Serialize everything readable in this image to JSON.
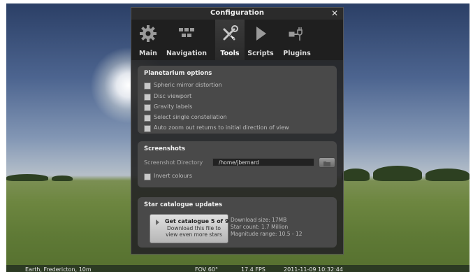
{
  "dialog": {
    "title": "Configuration",
    "close": "✕",
    "tabs": [
      {
        "label": "Main",
        "icon": "gear-icon"
      },
      {
        "label": "Navigation",
        "icon": "navigation-icon"
      },
      {
        "label": "Tools",
        "icon": "wrench-icon"
      },
      {
        "label": "Scripts",
        "icon": "play-icon"
      },
      {
        "label": "Plugins",
        "icon": "plug-icon"
      }
    ],
    "active_tab": "Tools"
  },
  "planetarium": {
    "title": "Planetarium options",
    "options": [
      {
        "label": "Spheric mirror distortion",
        "checked": false
      },
      {
        "label": "Disc viewport",
        "checked": false
      },
      {
        "label": "Gravity labels",
        "checked": false
      },
      {
        "label": "Select single constellation",
        "checked": false
      },
      {
        "label": "Auto zoom out returns to initial direction of view",
        "checked": false
      }
    ]
  },
  "screenshots": {
    "title": "Screenshots",
    "dir_label": "Screenshot Directory",
    "dir_value": "/home/jbernard",
    "invert_label": "Invert colours",
    "invert_checked": false
  },
  "catalogue": {
    "title": "Star catalogue updates",
    "button_title": "Get catalogue 5 of 9",
    "button_line1": "Download this file to",
    "button_line2": "view even more stars",
    "info": [
      "Download size: 17MB",
      "Star count: 1.7 Million",
      "Magnitude range: 10.5 - 12"
    ]
  },
  "status": {
    "location": "Earth, Fredericton, 10m",
    "fov": "FOV 60°",
    "fps": "17.4 FPS",
    "datetime": "2011-11-09   10:32:44"
  },
  "colors": {
    "dialog_bg": "#262626",
    "panel_bg": "#4b4b4b",
    "sky_top": "#2b3f66",
    "ground": "#5f7a36"
  }
}
